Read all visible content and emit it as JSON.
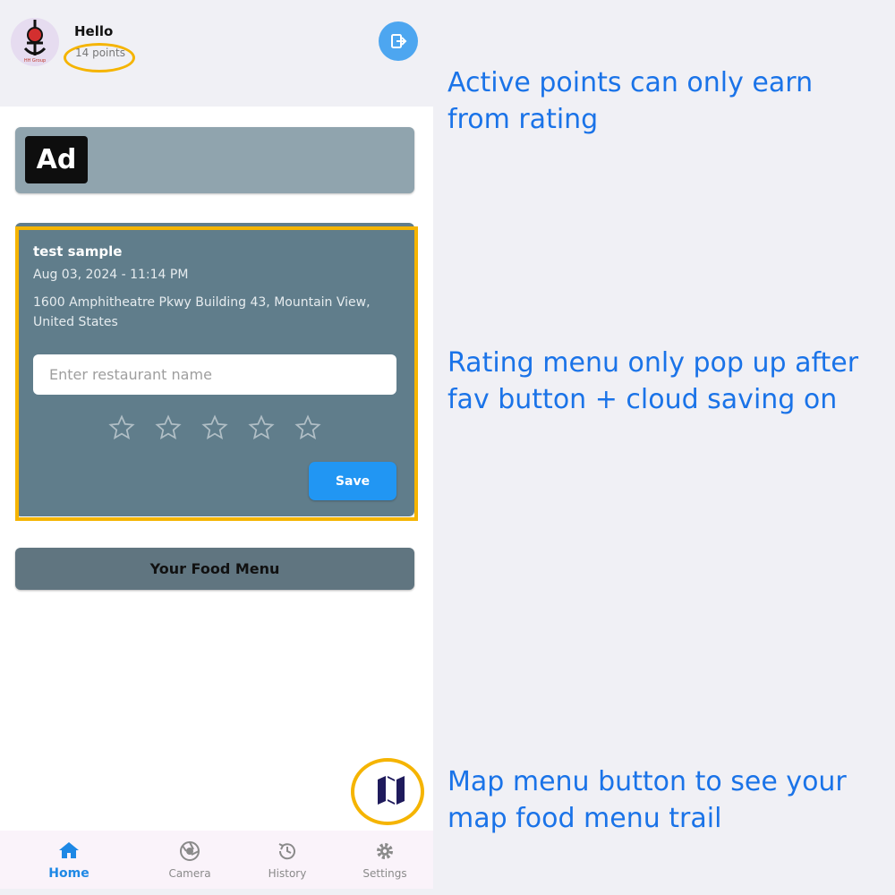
{
  "header": {
    "greeting": "Hello",
    "points": "14 points",
    "logout_icon": "logout-icon",
    "avatar_logo_text": "HH Group"
  },
  "ad": {
    "label": "Ad"
  },
  "rating_card": {
    "title": "test sample",
    "date": "Aug 03, 2024 - 11:14 PM",
    "address": "1600 Amphitheatre Pkwy Building 43, Mountain View, United States",
    "input_placeholder": "Enter restaurant name",
    "input_value": "",
    "rating": 0,
    "max_rating": 5,
    "save_label": "Save"
  },
  "food_menu_label": "Your Food Menu",
  "map_button_icon": "map-icon",
  "bottom_nav": [
    {
      "label": "Home",
      "icon": "home-icon",
      "active": true
    },
    {
      "label": "Camera",
      "icon": "camera-icon",
      "active": false
    },
    {
      "label": "History",
      "icon": "history-icon",
      "active": false
    },
    {
      "label": "Settings",
      "icon": "gear-icon",
      "active": false
    }
  ],
  "annotations": {
    "points_note": "Active points can only earn from rating",
    "rating_note": "Rating menu only pop up after fav button + cloud saving on",
    "map_note": "Map menu  button to see  your map food menu trail"
  },
  "colors": {
    "highlight": "#f5b400",
    "accent": "#2196f3",
    "annotation_text": "#1a73e8",
    "card": "#607d8b",
    "ad_card": "#90a4ae"
  }
}
